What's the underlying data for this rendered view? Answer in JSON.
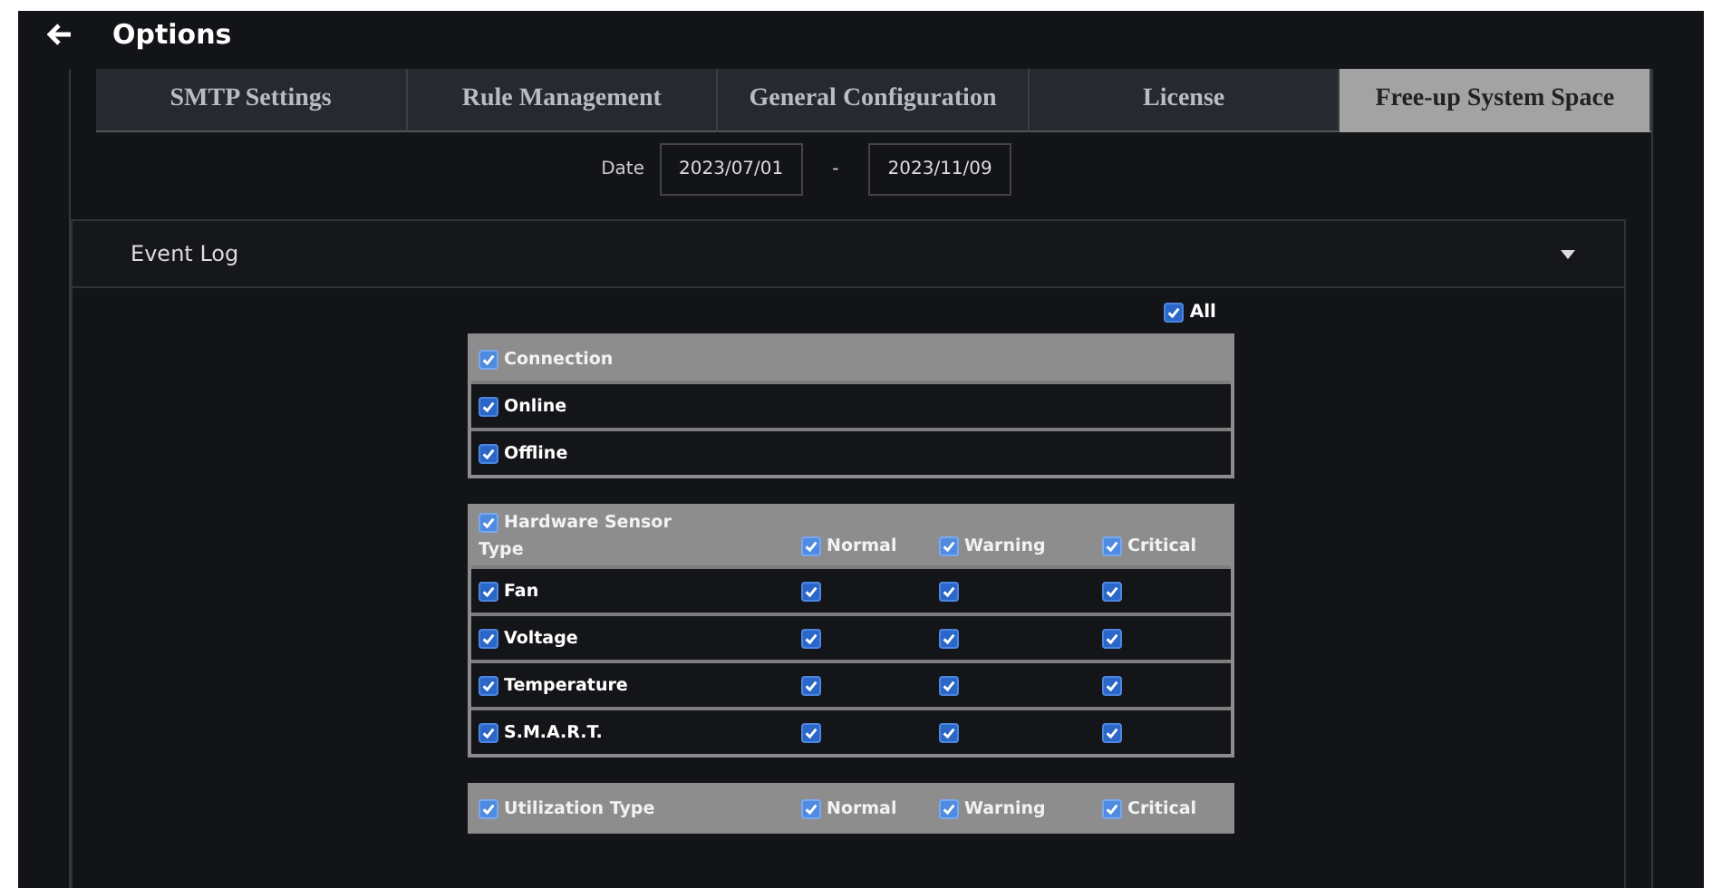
{
  "window": {
    "title": "Options"
  },
  "tabs": [
    {
      "label": "SMTP Settings",
      "selected": false
    },
    {
      "label": "Rule Management",
      "selected": false
    },
    {
      "label": "General Configuration",
      "selected": false
    },
    {
      "label": "License",
      "selected": false
    },
    {
      "label": "Free-up System Space",
      "selected": true
    }
  ],
  "date_range": {
    "label": "Date",
    "start": "2023/07/01",
    "separator": "-",
    "end": "2023/11/09"
  },
  "event_log": {
    "title": "Event Log",
    "expanded": true,
    "all": {
      "label": "All",
      "checked": true
    },
    "groups": [
      {
        "kind": "list",
        "title": "Connection",
        "checked": true,
        "rows": [
          {
            "label": "Online",
            "checked": true
          },
          {
            "label": "Offline",
            "checked": true
          }
        ]
      },
      {
        "kind": "matrix",
        "title": "Hardware Sensor",
        "subtitle": "Type",
        "checked": true,
        "columns": [
          {
            "label": "Normal",
            "checked": true
          },
          {
            "label": "Warning",
            "checked": true
          },
          {
            "label": "Critical",
            "checked": true
          }
        ],
        "rows": [
          {
            "label": "Fan",
            "checked": true,
            "cells": [
              {
                "checked": true
              },
              {
                "checked": true
              },
              {
                "checked": true
              }
            ]
          },
          {
            "label": "Voltage",
            "checked": true,
            "cells": [
              {
                "checked": true
              },
              {
                "checked": true
              },
              {
                "checked": true
              }
            ]
          },
          {
            "label": "Temperature",
            "checked": true,
            "cells": [
              {
                "checked": true
              },
              {
                "checked": true
              },
              {
                "checked": true
              }
            ]
          },
          {
            "label": "S.M.A.R.T.",
            "checked": true,
            "cells": [
              {
                "checked": true
              },
              {
                "checked": true
              },
              {
                "checked": true
              }
            ]
          }
        ]
      },
      {
        "kind": "matrix",
        "title": "Utilization Type",
        "checked": true,
        "columns": [
          {
            "label": "Normal",
            "checked": true
          },
          {
            "label": "Warning",
            "checked": true
          },
          {
            "label": "Critical",
            "checked": true
          }
        ]
      }
    ]
  }
}
